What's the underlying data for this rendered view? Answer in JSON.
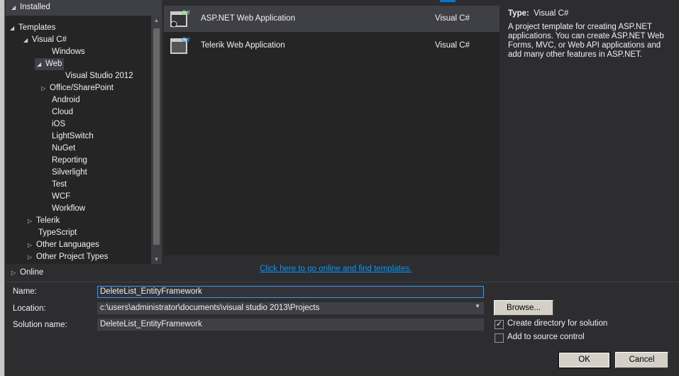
{
  "installed": "Installed",
  "tree": [
    {
      "label": "Templates",
      "level": 0,
      "exp": "open"
    },
    {
      "label": "Visual C#",
      "level": 1,
      "exp": "open"
    },
    {
      "label": "Windows",
      "level": 2,
      "exp": ""
    },
    {
      "label": "Web",
      "level": 2,
      "exp": "open",
      "selected": true
    },
    {
      "label": "Visual Studio 2012",
      "level": 3,
      "exp": ""
    },
    {
      "label": "Office/SharePoint",
      "level": 2,
      "exp": "closed"
    },
    {
      "label": "Android",
      "level": 2,
      "exp": ""
    },
    {
      "label": "Cloud",
      "level": 2,
      "exp": ""
    },
    {
      "label": "iOS",
      "level": 2,
      "exp": ""
    },
    {
      "label": "LightSwitch",
      "level": 2,
      "exp": ""
    },
    {
      "label": "NuGet",
      "level": 2,
      "exp": ""
    },
    {
      "label": "Reporting",
      "level": 2,
      "exp": ""
    },
    {
      "label": "Silverlight",
      "level": 2,
      "exp": ""
    },
    {
      "label": "Test",
      "level": 2,
      "exp": ""
    },
    {
      "label": "WCF",
      "level": 2,
      "exp": ""
    },
    {
      "label": "Workflow",
      "level": 2,
      "exp": ""
    },
    {
      "label": "Telerik",
      "level": 1,
      "exp": "closed"
    },
    {
      "label": "TypeScript",
      "level": 1,
      "exp": ""
    },
    {
      "label": "Other Languages",
      "level": 1,
      "exp": "closed"
    },
    {
      "label": "Other Project Types",
      "level": 1,
      "exp": "closed"
    }
  ],
  "online": "Online",
  "templates": [
    {
      "name": "ASP.NET Web Application",
      "lang": "Visual C#",
      "badge": "C#",
      "badge_color": "#7ed67e"
    },
    {
      "name": "Telerik Web Application",
      "lang": "Visual C#",
      "badge": "C#",
      "badge_color": "#3a9ee8"
    }
  ],
  "details": {
    "type_label": "Type:",
    "type_value": "Visual C#",
    "description": "A project template for creating ASP.NET applications. You can create ASP.NET Web Forms, MVC,  or Web API applications and add many other features in ASP.NET."
  },
  "online_link": "Click here to go online and find templates.",
  "form": {
    "name_label": "Name:",
    "name_value": "DeleteList_EntityFramework",
    "location_label": "Location:",
    "location_value": "c:\\users\\administrator\\documents\\visual studio 2013\\Projects",
    "solution_label": "Solution name:",
    "solution_value": "DeleteList_EntityFramework",
    "browse": "Browse...",
    "create_dir": "Create directory for solution",
    "create_dir_checked": true,
    "source_control": "Add to source control",
    "source_control_checked": false,
    "ok": "OK",
    "cancel": "Cancel"
  }
}
